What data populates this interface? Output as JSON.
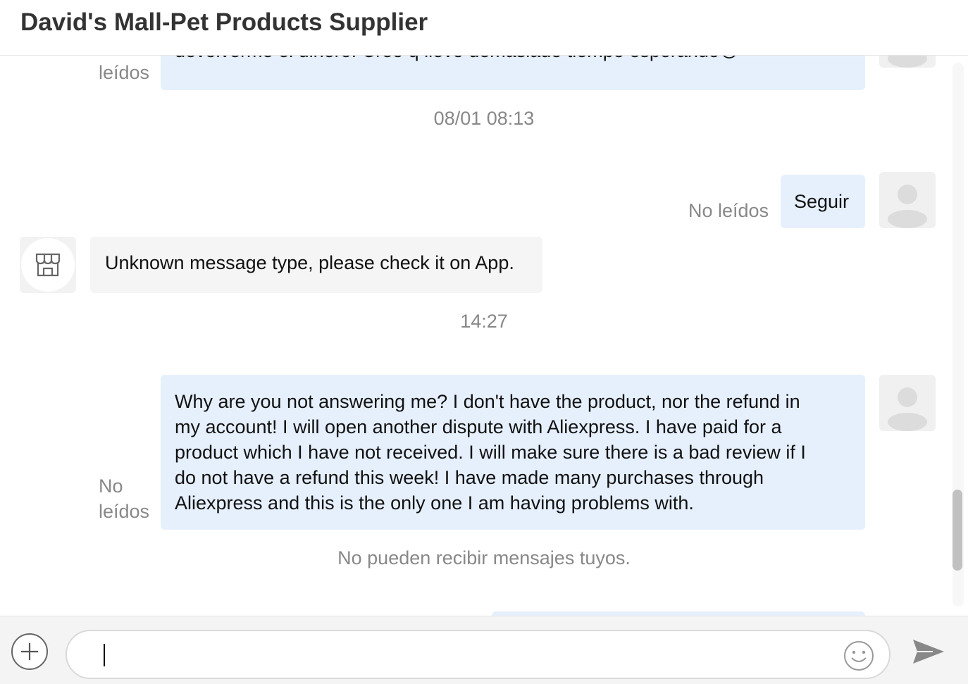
{
  "header": {
    "title": "David's Mall-Pet Products Supplier"
  },
  "messages": {
    "m1": {
      "status": "leídos",
      "text": "devolverme el dinero. Creo q llevo demasiado tiempo esperando😠"
    },
    "ts1": "08/01 08:13",
    "m2": {
      "status": "No leídos",
      "text": "Seguir"
    },
    "m3": {
      "text": "Unknown message type, please check it on App."
    },
    "ts2": "14:27",
    "m4": {
      "status_line1": "No",
      "status_line2": "leídos",
      "lines": [
        "Why are you not answering me? I don't have the product, nor the refund in",
        "my account! I will open another dispute with Aliexpress. I have paid for a",
        "product which I have not received. I will make sure there is a bad review if I",
        "do not have a refund this week! I have made many purchases through",
        "Aliexpress and this is the only one I am having problems with."
      ]
    },
    "notice": "No pueden recibir mensajes tuyos."
  },
  "composer": {
    "input_value": "",
    "placeholder": ""
  },
  "icons": {
    "add": "plus-icon",
    "emoji": "smiley-icon",
    "send": "send-icon",
    "shop": "store-icon",
    "user": "user-avatar-icon"
  },
  "colors": {
    "outgoing_bubble": "#e6f0fd",
    "incoming_bubble": "#f5f5f5",
    "status_text": "#888888"
  }
}
